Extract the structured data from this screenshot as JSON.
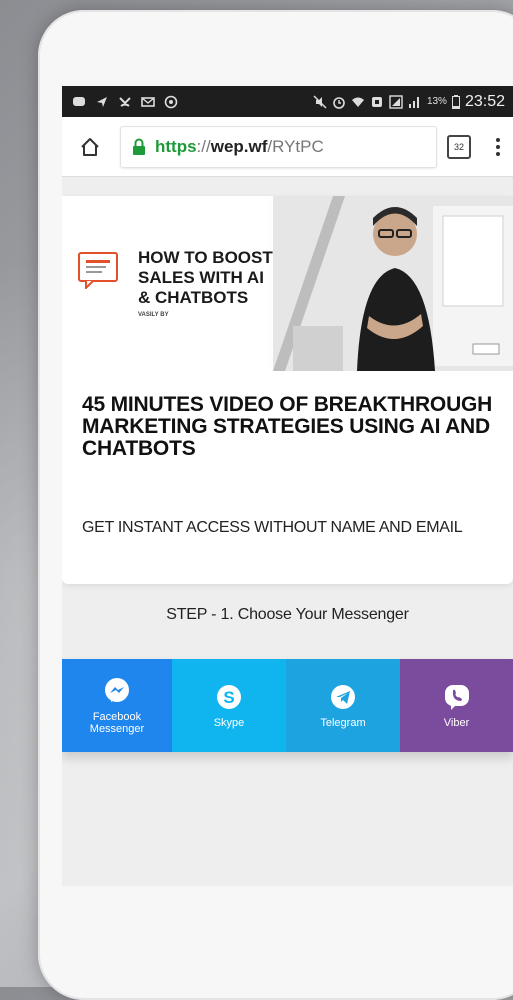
{
  "status_bar": {
    "battery_percent": "13%",
    "time": "23:52"
  },
  "browser": {
    "url_scheme": "https",
    "url_separator": "://",
    "url_host": "wep.wf",
    "url_path": "/RYtPC",
    "tab_count": "32"
  },
  "banner": {
    "title": "HOW TO BOOST\nSALES WITH AI\n& CHATBOTS",
    "author": "VASILY BY"
  },
  "main": {
    "headline": "45 MINUTES VIDEO OF BREAKTHROUGH MARKETING STRATEGIES USING AI AND CHATBOTS",
    "subline": "GET INSTANT ACCESS WITHOUT NAME AND EMAIL",
    "step_label": "STEP - 1. Choose Your Messenger"
  },
  "messengers": [
    {
      "label": "Facebook\nMessenger",
      "icon": "messenger-icon",
      "color": "#1f86ee"
    },
    {
      "label": "Skype",
      "icon": "skype-icon",
      "color": "#10b4ef"
    },
    {
      "label": "Telegram",
      "icon": "telegram-icon",
      "color": "#1ea3e1"
    },
    {
      "label": "Viber",
      "icon": "viber-icon",
      "color": "#7b4b9d"
    }
  ]
}
